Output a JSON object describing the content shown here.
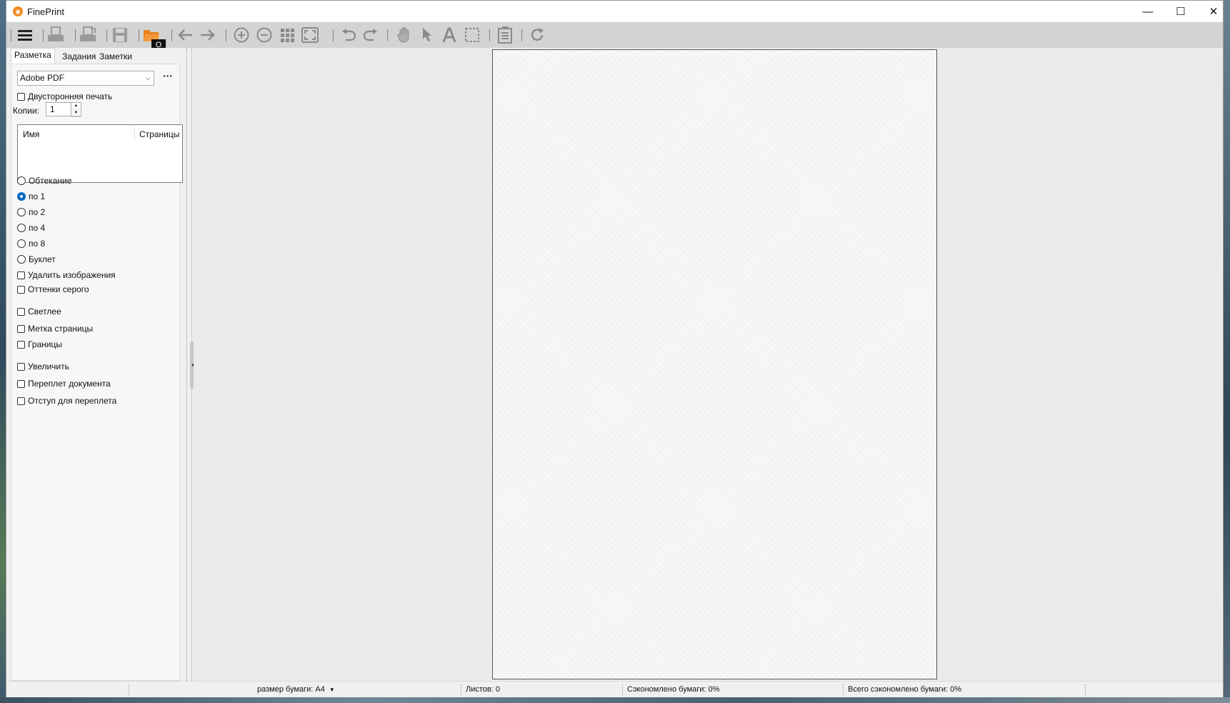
{
  "window": {
    "title": "FinePrint",
    "minimize_glyph": "—",
    "maximize_glyph": "☐",
    "close_glyph": "✕"
  },
  "toolbar": {
    "tooltip": "O",
    "buttons": [
      "menu-icon",
      "printer-icon",
      "print-preview-icon",
      "save-icon",
      "open-folder-icon",
      "arrow-left-icon",
      "arrow-right-icon",
      "zoom-in-icon",
      "zoom-out-icon",
      "grid-icon",
      "fit-page-icon",
      "undo-icon",
      "redo-icon",
      "hand-icon",
      "pointer-icon",
      "text-icon",
      "select-rect-icon",
      "notes-icon",
      "refresh-icon"
    ]
  },
  "tabs": [
    "Разметка",
    "Задания",
    "Заметки"
  ],
  "printer": {
    "selected": "Adobe PDF",
    "more": "···"
  },
  "options": {
    "duplex": "Двусторонняя печать",
    "copies_label": "Копии:",
    "copies_value": "1"
  },
  "list": {
    "col_name": "Имя",
    "col_pages": "Страницы"
  },
  "layout_options": [
    {
      "label": "Обтекание",
      "checked": false
    },
    {
      "label": "по 1",
      "checked": true
    },
    {
      "label": "по 2",
      "checked": false
    },
    {
      "label": "по 4",
      "checked": false
    },
    {
      "label": "по 8",
      "checked": false
    },
    {
      "label": "Буклет",
      "checked": false
    }
  ],
  "checkboxes": {
    "remove_images": "Удалить изображения",
    "grayscale": "Оттенки серого",
    "lighter": "Светлее",
    "page_mark": "Метка страницы",
    "borders": "Границы",
    "enlarge": "Увеличить",
    "binding": "Переплет документа",
    "binding_margin": "Отступ для переплета"
  },
  "status": {
    "paper_size": "размер бумаги: A4",
    "sheets": "Листов: 0",
    "saved": "Сэкономлено бумаги: 0%",
    "total_saved": "Всего сэкономлено бумаги: 0%"
  },
  "colors": {
    "accent": "#0067c0",
    "folder_orange": "#e8821e",
    "toolbar_bg": "#d3d3d3"
  }
}
